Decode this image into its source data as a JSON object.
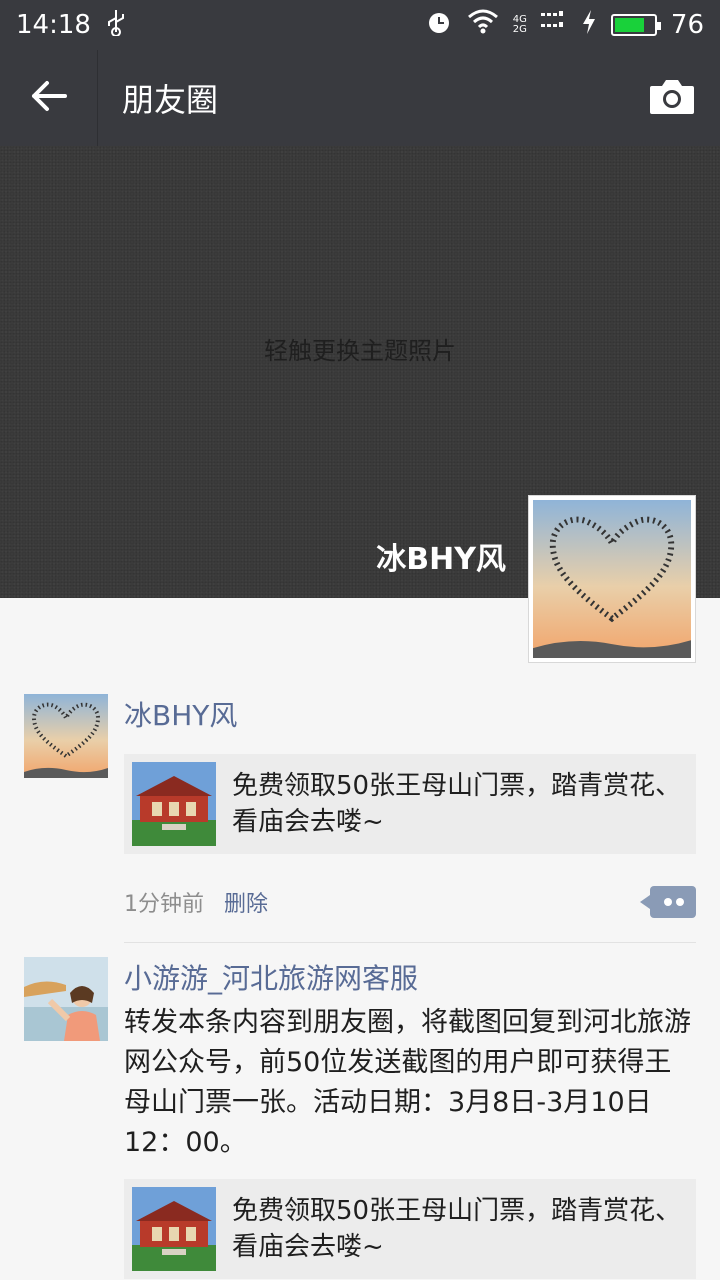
{
  "status_bar": {
    "time": "14:18",
    "battery_level": "76",
    "network_top": "4G",
    "network_bottom": "2G",
    "battery_fill_fraction": 0.76
  },
  "app_bar": {
    "title": "朋友圈"
  },
  "cover": {
    "hint": "轻触更换主题照片",
    "user_name": "冰BHY风"
  },
  "posts": [
    {
      "name": "冰BHY风",
      "text": "",
      "link_text": "免费领取50张王母山门票，踏青赏花、看庙会去喽~",
      "time": "1分钟前",
      "delete_label": "删除"
    },
    {
      "name": "小游游_河北旅游网客服",
      "text": "转发本条内容到朋友圈，将截图回复到河北旅游网公众号，前50位发送截图的用户即可获得王母山门票一张。活动日期：3月8日-3月10日12：00。",
      "link_text": "免费领取50张王母山门票，踏青赏花、看庙会去喽~"
    }
  ],
  "icons": {
    "back": "arrow-left-icon",
    "camera": "camera-icon",
    "usb": "usb-icon",
    "alarm": "alarm-icon",
    "wifi": "wifi-icon",
    "signal": "signal-icon",
    "charging": "charging-icon",
    "more": "more-icon"
  },
  "colors": {
    "bar_bg": "#393a3f",
    "name_blue": "#586b95",
    "battery_green": "#19d13a"
  }
}
